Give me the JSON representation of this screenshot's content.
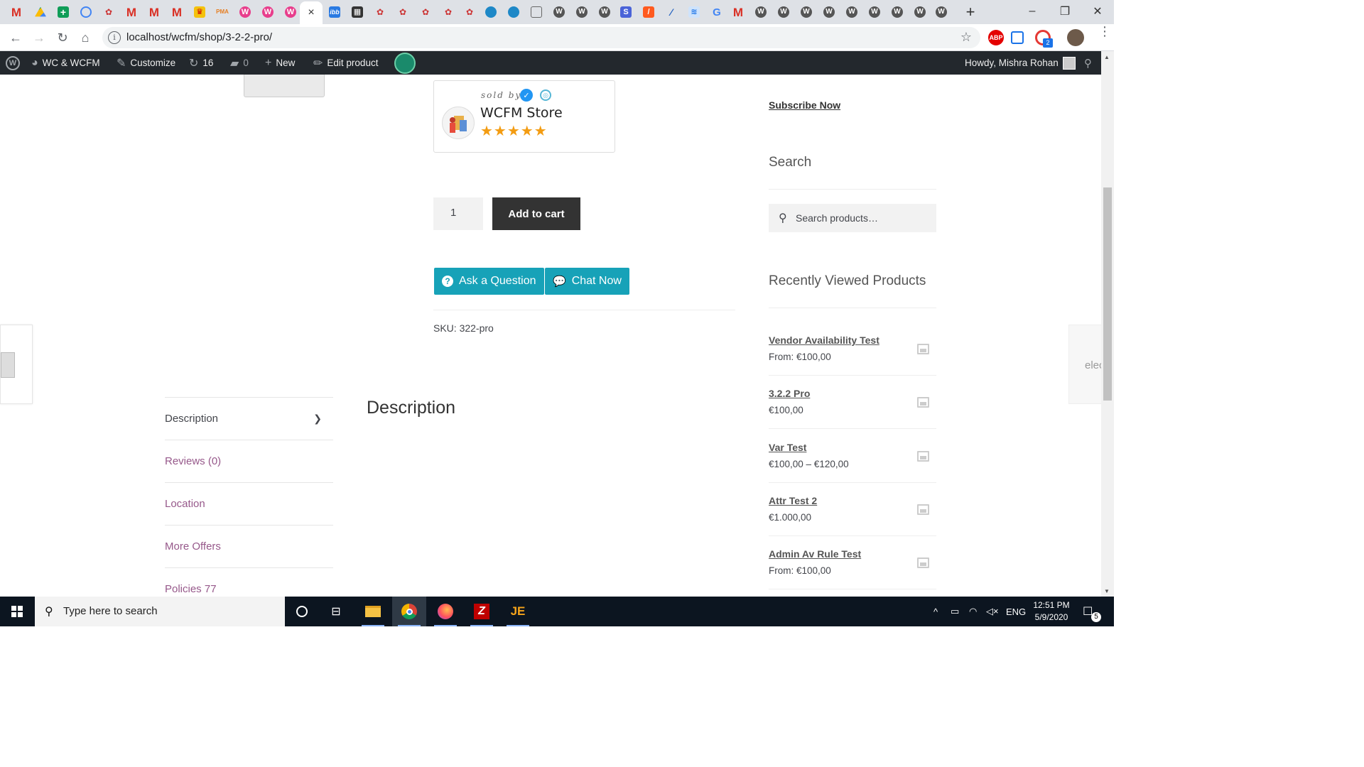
{
  "browser": {
    "active_tab_close": "×",
    "new_tab": "+",
    "url": "localhost/wcfm/shop/3-2-2-pro/",
    "window_controls": {
      "minimize": "–",
      "maximize": "❐",
      "close": "✕"
    },
    "tab_icons": [
      "gmail-icon",
      "drive-icon",
      "sheets-icon",
      "inbox-icon",
      "flower-icon",
      "gmail-icon",
      "gmail-icon",
      "gmail-icon",
      "trophy-icon",
      "pma-icon",
      "wcfm-icon",
      "wcfm-icon",
      "wcfm-icon",
      "active-tab",
      "ibb-icon",
      "film-icon",
      "flower-icon",
      "flower-icon",
      "flower-icon",
      "flower-icon",
      "flower-icon",
      "globe-icon",
      "globe-icon",
      "monitor-icon",
      "wordpress-icon",
      "wordpress-icon",
      "wordpress-icon",
      "s-icon",
      "codeanywhere-icon",
      "feather-icon",
      "translate-icon",
      "google-icon",
      "gmail-icon",
      "wordpress-icon",
      "wordpress-icon",
      "wordpress-icon",
      "wordpress-icon",
      "wordpress-icon",
      "wordpress-icon",
      "wordpress-icon",
      "wordpress-icon"
    ],
    "extensions": {
      "abp": "ABP",
      "badge": "2"
    }
  },
  "wpbar": {
    "site": "WC & WCFM",
    "customize": "Customize",
    "updates": "16",
    "comments": "0",
    "new": "New",
    "edit": "Edit product",
    "howdy": "Howdy, Mishra Rohan"
  },
  "product": {
    "sold_by": "sold by",
    "store_name": "WCFM Store",
    "rating_stars": "★★★★★",
    "qty": "1",
    "add_to_cart": "Add to cart",
    "ask_question": "Ask a Question",
    "chat_now": "Chat Now",
    "sku": "SKU: 322-pro"
  },
  "side_right_text": "elec",
  "tabs": [
    {
      "label": "Description"
    },
    {
      "label": "Reviews (0)"
    },
    {
      "label": "Location"
    },
    {
      "label": "More Offers"
    },
    {
      "label": "Policies 77"
    }
  ],
  "description_title": "Description",
  "sidebar": {
    "subscribe": "Subscribe Now",
    "search_heading": "Search",
    "search_placeholder": "Search products…",
    "recent_heading": "Recently Viewed Products",
    "recent": [
      {
        "name": "Vendor Availability Test",
        "price": "From: €100,00"
      },
      {
        "name": "3.2.2 Pro",
        "price": "€100,00"
      },
      {
        "name": "Var Test",
        "price": "€100,00 – €120,00"
      },
      {
        "name": "Attr Test 2",
        "price": "€1.000,00"
      },
      {
        "name": "Admin Av Rule Test",
        "price": "From: €100,00"
      }
    ]
  },
  "taskbar": {
    "search_text": "Type here to search",
    "lang": "ENG",
    "time": "12:51 PM",
    "date": "5/9/2020",
    "notifications": "5"
  },
  "colors": {
    "teal": "#17a2b8",
    "wp_bar": "#23282d",
    "tab_link": "#96588a",
    "star": "#f39c12"
  }
}
